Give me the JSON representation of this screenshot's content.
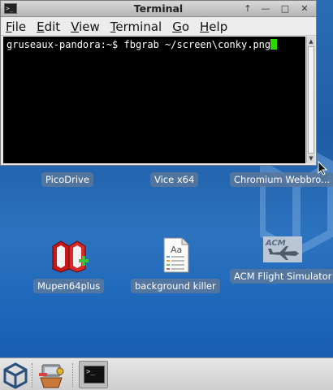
{
  "window": {
    "title": "Terminal",
    "menu": [
      {
        "mnemonic": "F",
        "rest": "ile"
      },
      {
        "mnemonic": "E",
        "rest": "dit"
      },
      {
        "mnemonic": "V",
        "rest": "iew"
      },
      {
        "mnemonic": "T",
        "rest": "erminal"
      },
      {
        "mnemonic": "G",
        "rest": "o"
      },
      {
        "mnemonic": "H",
        "rest": "elp"
      }
    ],
    "terminal": {
      "prompt": "gruseaux-pandora:~$ ",
      "command": "fbgrab ~/screen\\conky.png"
    }
  },
  "desktop": {
    "icons": [
      {
        "label": "PicoDrive"
      },
      {
        "label": "Vice x64"
      },
      {
        "label": "Chromium Webbro..."
      },
      {
        "label": "Mupen64plus"
      },
      {
        "label": "background killer"
      },
      {
        "label": "ACM Flight Simulator"
      }
    ],
    "acm_logo_text": "ACM",
    "doc_icon_text": "Aa"
  },
  "taskbar": {
    "terminal_glyph": ">_"
  },
  "colors": {
    "desktop_blue": "#1f5ea6",
    "cursor_green": "#2bd900",
    "terminal_bg": "#000000"
  }
}
